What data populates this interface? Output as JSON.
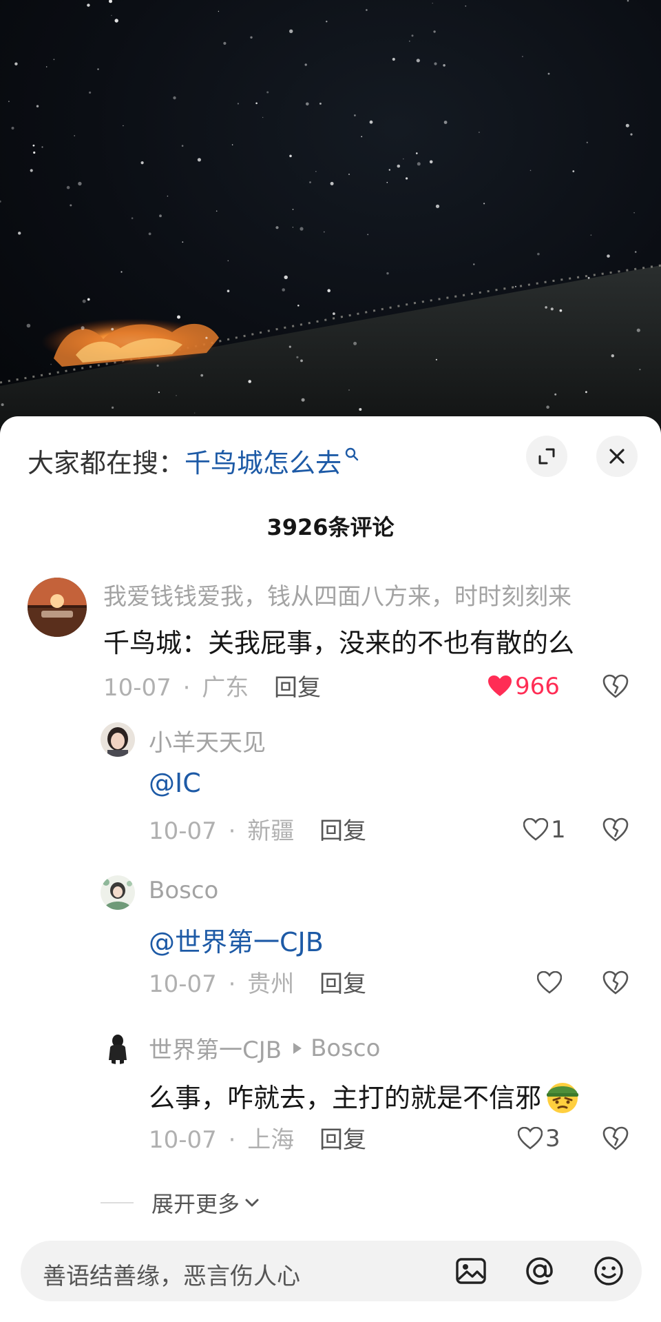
{
  "search": {
    "prefix": "大家都在搜：",
    "term": "千鸟城怎么去"
  },
  "comment_count": "3926条评论",
  "comments": [
    {
      "user": "我爱钱钱爱我，钱从四面八方来，时时刻刻来",
      "text": "千鸟城：关我屁事，没来的不也有散的么",
      "date": "10-07",
      "location": "广东",
      "reply_label": "回复",
      "likes": "966",
      "liked": true
    },
    {
      "user": "小羊天天见",
      "text": "@IC",
      "date": "10-07",
      "location": "新疆",
      "reply_label": "回复",
      "likes": "1"
    },
    {
      "user": "Bosco",
      "text": "@世界第一CJB",
      "date": "10-07",
      "location": "贵州",
      "reply_label": "回复",
      "likes": ""
    },
    {
      "user": "世界第一CJB",
      "reply_to": "Bosco",
      "text": "么事，咋就去，主打的就是不信邪",
      "date": "10-07",
      "location": "上海",
      "reply_label": "回复",
      "likes": "3"
    }
  ],
  "meta_separator": "·",
  "expand_more": "展开更多",
  "input": {
    "placeholder": "善语结善缘，恶言伤人心"
  },
  "colors": {
    "accent_blue": "#1d5aa6",
    "like_red": "#ff2d55",
    "sheet_bg": "#ffffff"
  },
  "icons": [
    "search-icon",
    "expand-icon",
    "close-icon",
    "heart-icon",
    "broken-heart-icon",
    "chevron-down-icon",
    "image-icon",
    "at-icon",
    "emoji-icon"
  ]
}
